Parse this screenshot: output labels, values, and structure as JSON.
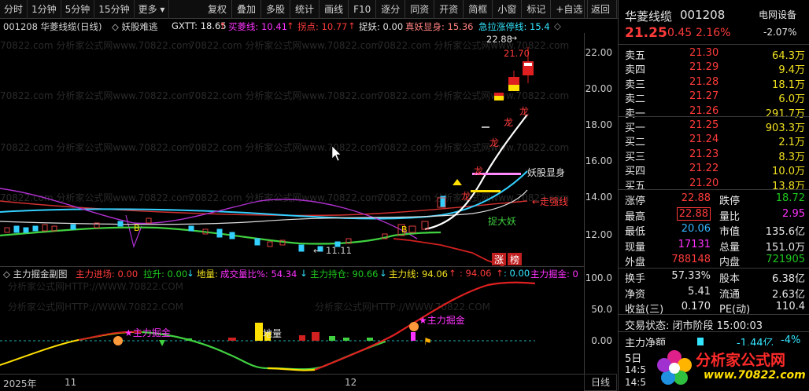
{
  "toolbar": {
    "left": [
      "分时",
      "1分钟",
      "5分钟",
      "15分钟",
      "更多 ▾"
    ],
    "right": [
      "复权",
      "叠加",
      "多股",
      "统计",
      "画线",
      "F10",
      "逐分",
      "同资",
      "开资",
      "简框",
      "小窗",
      "标记",
      "+自选"
    ],
    "return_label": "返回"
  },
  "chart_header": {
    "code_name": "001208 华菱线缆(日线)",
    "indicator": "◇ 妖股难逃",
    "gxtt": "GXTT: 18.65",
    "gxtt_arrow": "↑",
    "buy_line": "买菱线: 10.41",
    "buy_arrow": "↑",
    "catch": "拐点: 10.77",
    "catch_arrow": "↑",
    "catch_yao": "捉妖: 0.00",
    "true_yao": "真妖显身: 15.36",
    "rush": "急拉涨停线: 15.4"
  },
  "main_axis": [
    "22.00",
    "20.00",
    "18.00",
    "16.00",
    "14.00",
    "12.00"
  ],
  "main_labels": {
    "hi": "22.88",
    "hi2": "21.70",
    "dragon": "龙",
    "yao_show": "妖股显身",
    "walk_strong": "←走强线",
    "catch_yao": "捉大妖",
    "low": "11.11",
    "zhang": "涨",
    "bang": "榜",
    "b": "B",
    "watermark": "70822.com 分析家公式网www.70822.com"
  },
  "sub_header": {
    "title": "◇ 主力掘金副图",
    "enter": "主力进场: 0.00",
    "pull": "拉升: 0.00",
    "pull_arrow": "↓",
    "ground": "地量:",
    "ratio": "成交量比%: 54.34",
    "ratio_arrow": "↓",
    "hold": "主力持仓: 90.66",
    "hold_arrow": "↓",
    "line": "主力线: 94.06",
    "line_arrow": "↑",
    "v2": ": 94.06",
    "v2_arrow": "↑",
    "v3": ": 0.00",
    "jue": "主力掘金: 0"
  },
  "sub_axis": [
    "100.0",
    "50.0",
    "0.00"
  ],
  "sub_labels": {
    "jue1": "★主力掘金",
    "jue2": "★主力掘金",
    "ground": "地量",
    "watermark": "分析家公式网HTTP://WWW.70822.COM"
  },
  "time_axis": {
    "year": "2025年",
    "m1": "11",
    "m2": "12",
    "day_btn": "日线"
  },
  "panel": {
    "name": "华菱线缆",
    "code": "001208",
    "sector": "电网设备",
    "price": "21.25",
    "change": "0.45",
    "pct": "2.16%",
    "sector_pct": "-2.07%",
    "sell_title": "卖五 ¥",
    "asks": [
      {
        "label": "卖五",
        "price": "21.30",
        "vol": "64.3万"
      },
      {
        "label": "卖四",
        "price": "21.29",
        "vol": "9.4万"
      },
      {
        "label": "卖三",
        "price": "21.28",
        "vol": "18.1万"
      },
      {
        "label": "卖二",
        "price": "21.27",
        "vol": "6.0万"
      },
      {
        "label": "卖一",
        "price": "21.26",
        "vol": "291.7万"
      }
    ],
    "bids": [
      {
        "label": "买一",
        "price": "21.25",
        "vol": "903.3万"
      },
      {
        "label": "买二",
        "price": "21.24",
        "vol": "2.1万"
      },
      {
        "label": "买三",
        "price": "21.23",
        "vol": "8.3万"
      },
      {
        "label": "买四",
        "price": "21.22",
        "vol": "10.0万"
      },
      {
        "label": "买五",
        "price": "21.20",
        "vol": "13.8万"
      }
    ],
    "stats": [
      {
        "l1": "涨停",
        "v1": "22.88",
        "l2": "跌停",
        "v2": "18.72"
      },
      {
        "l1": "最高",
        "v1": "22.88",
        "l2": "量比",
        "v2": "2.95"
      },
      {
        "l1": "最低",
        "v1": "20.06",
        "l2": "市值",
        "v2": "135.6亿"
      },
      {
        "l1": "现量",
        "v1": "17131",
        "l2": "总量",
        "v2": "151.0万"
      },
      {
        "l1": "外盘",
        "v1": "788148",
        "l2": "内盘",
        "v2": "721905"
      }
    ],
    "stats2": [
      {
        "l1": "换手",
        "v1": "57.33%",
        "l2": "股本",
        "v2": "6.38亿"
      },
      {
        "l1": "净资",
        "v1": "5.41",
        "l2": "流通",
        "v2": "2.63亿"
      },
      {
        "l1": "收益(三)",
        "v1": "0.170",
        "l2": "PE(动)",
        "v2": "110.4"
      }
    ],
    "status": "交易状态: 闭市阶段 15:00:03",
    "net_label": "主力净额",
    "net_value": "-1.44亿",
    "net_pct": "-4%",
    "day5": "5日",
    "t1": "14:5",
    "t2": "14:5",
    "logo_text": "分析家公式网",
    "logo_url": "www.70822.com"
  }
}
